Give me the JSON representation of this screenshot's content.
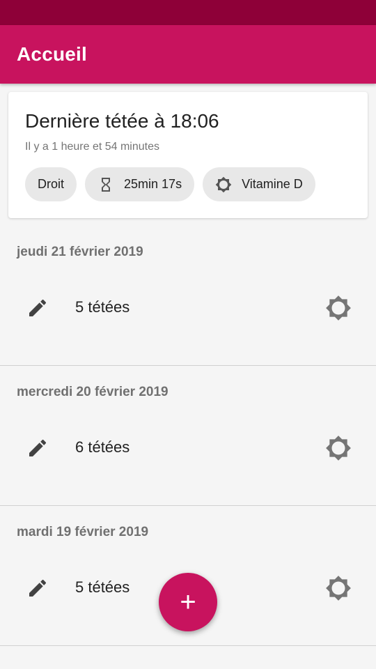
{
  "app_bar": {
    "title": "Accueil"
  },
  "last_feed": {
    "title": "Dernière tétée à 18:06",
    "subtitle": "Il y a 1 heure et 54 minutes",
    "chips": {
      "side": "Droit",
      "duration": "25min 17s",
      "vitamin": "Vitamine D"
    }
  },
  "days": [
    {
      "date": "jeudi 21 février 2019",
      "count": "5 tétées"
    },
    {
      "date": "mercredi 20 février 2019",
      "count": "6 tétées"
    },
    {
      "date": "mardi 19 février 2019",
      "count": "5 tétées"
    }
  ],
  "fab": {
    "label": "+"
  },
  "colors": {
    "primary": "#c8135e",
    "primary_dark": "#8e0038",
    "background": "#f5f5f5"
  },
  "icons": {
    "edit": "pencil-icon",
    "vitamin": "sun-icon",
    "duration": "hourglass-icon",
    "fab": "plus-icon"
  }
}
